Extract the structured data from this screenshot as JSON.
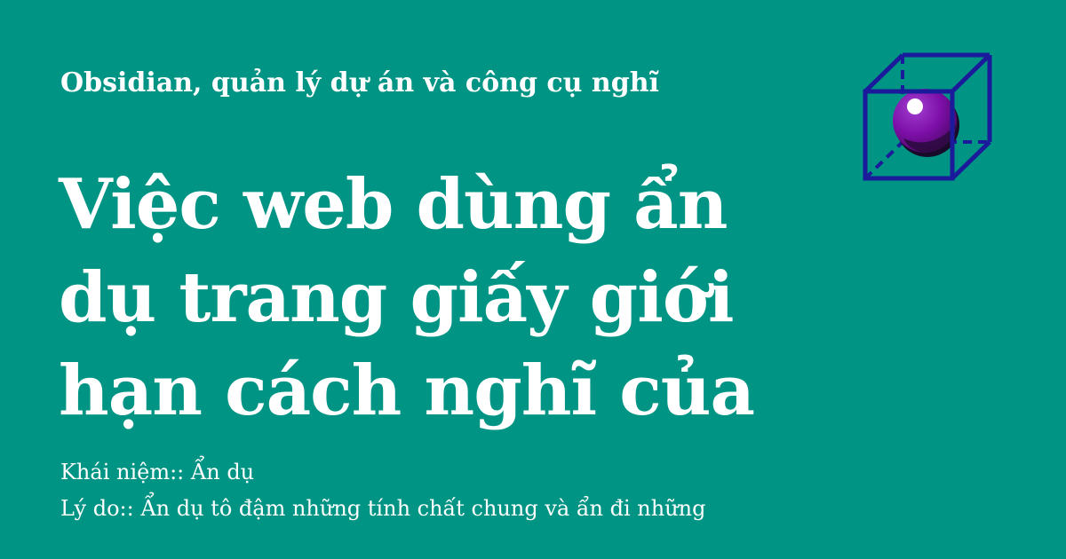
{
  "card": {
    "subtitle": "Obsidian, quản lý dự án và công cụ nghĩ",
    "title_lines": [
      "Việc web dùng ẩn",
      "dụ trang giấy giới",
      "hạn cách nghĩ của"
    ],
    "meta": [
      "Khái niệm:: Ẩn dụ",
      "Lý do:: Ẩn dụ tô đậm những tính chất chung và ẩn đi những"
    ]
  },
  "logo": {
    "icon": "cube-with-sphere-icon",
    "colors": {
      "cube": "#1a1a9a",
      "sphere": "#7d0fa8",
      "sphere_shadow": "#1a0a2a",
      "highlight": "#ffffff"
    }
  },
  "colors": {
    "background": "#009485",
    "text": "#ffffff"
  }
}
